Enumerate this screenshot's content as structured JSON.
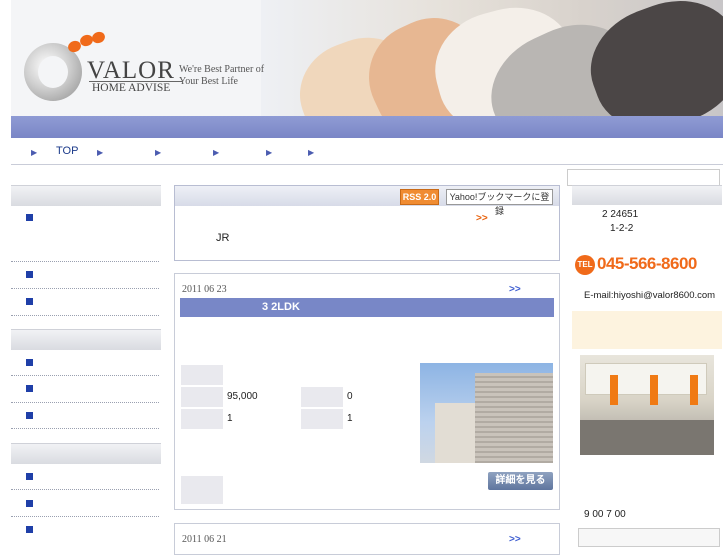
{
  "header": {
    "logo_title": "VALOR",
    "logo_subtitle": "HOME ADVISE",
    "tagline_line1": "We're Best Partner of",
    "tagline_line2": "Your Best Life"
  },
  "nav": {
    "items": [
      "TOP",
      "",
      "",
      "",
      "",
      ""
    ]
  },
  "notice": {
    "rss_label": "RSS 2.0",
    "yahoo_label": "Yahoo!ブックマークに登録",
    "more": ">>",
    "body": "JR"
  },
  "listings": [
    {
      "date": "2011 06 23",
      "more": ">>",
      "title": "3 2LDK",
      "rent": "95,000",
      "deposit": "0",
      "row2_left": "1",
      "row2_right": "1",
      "detail_button": "詳細を見る"
    },
    {
      "date": "2011 06 21",
      "more": ">>"
    }
  ],
  "sidebar_right": {
    "address_line1": "2 24651",
    "address_line2": "1-2-2",
    "tel_badge": "TEL",
    "tel": "045-566-8600",
    "email": "E-mail:hiyoshi@valor8600.com",
    "hours": "9 00 7 00"
  },
  "colors": {
    "accent": "#f06a1a",
    "band": "#7a86c6",
    "title_bar": "#7887c7",
    "nav_text": "#1b3a8a"
  },
  "icons": {
    "nav_arrow": "triangle-right-icon",
    "bullet": "square-bullet-icon"
  }
}
